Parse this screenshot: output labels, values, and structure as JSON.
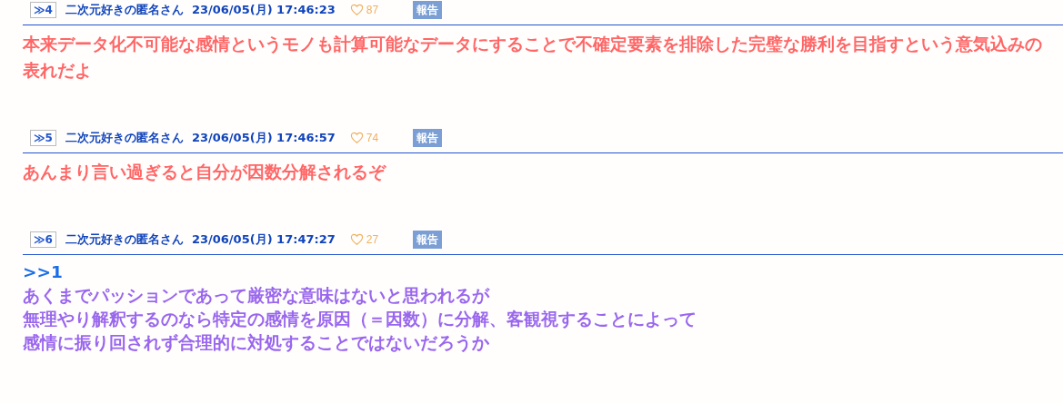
{
  "posts": [
    {
      "number": "≫4",
      "name": "二次元好きの匿名さん",
      "date": "23/06/05(月) 17:46:23",
      "likes": "87",
      "report": "報告",
      "body": [
        {
          "kind": "text",
          "color": "#ff6666",
          "text": "本来データ化不可能な感情というモノも計算可能なデータにすることで不確定要素を排除した完璧な勝利を目指すという意気込みの表れだよ"
        }
      ]
    },
    {
      "number": "≫5",
      "name": "二次元好きの匿名さん",
      "date": "23/06/05(月) 17:46:57",
      "likes": "74",
      "report": "報告",
      "body": [
        {
          "kind": "text",
          "color": "#ff6666",
          "text": "あんまり言い過ぎると自分が因数分解されるぞ"
        }
      ]
    },
    {
      "number": "≫6",
      "name": "二次元好きの匿名さん",
      "date": "23/06/05(月) 17:47:27",
      "likes": "27",
      "report": "報告",
      "body": [
        {
          "kind": "anchor",
          "color": "#1a6fe8",
          "text": ">>1"
        },
        {
          "kind": "text",
          "color": "#9966ee",
          "text": "あくまでパッションであって厳密な意味はないと思われるが"
        },
        {
          "kind": "text",
          "color": "#9966ee",
          "text": "無理やり解釈するのなら特定の感情を原因（＝因数）に分解、客観視することによって"
        },
        {
          "kind": "text",
          "color": "#9966ee",
          "text": "感情に振り回されず合理的に対処することではないだろうか"
        }
      ]
    }
  ]
}
